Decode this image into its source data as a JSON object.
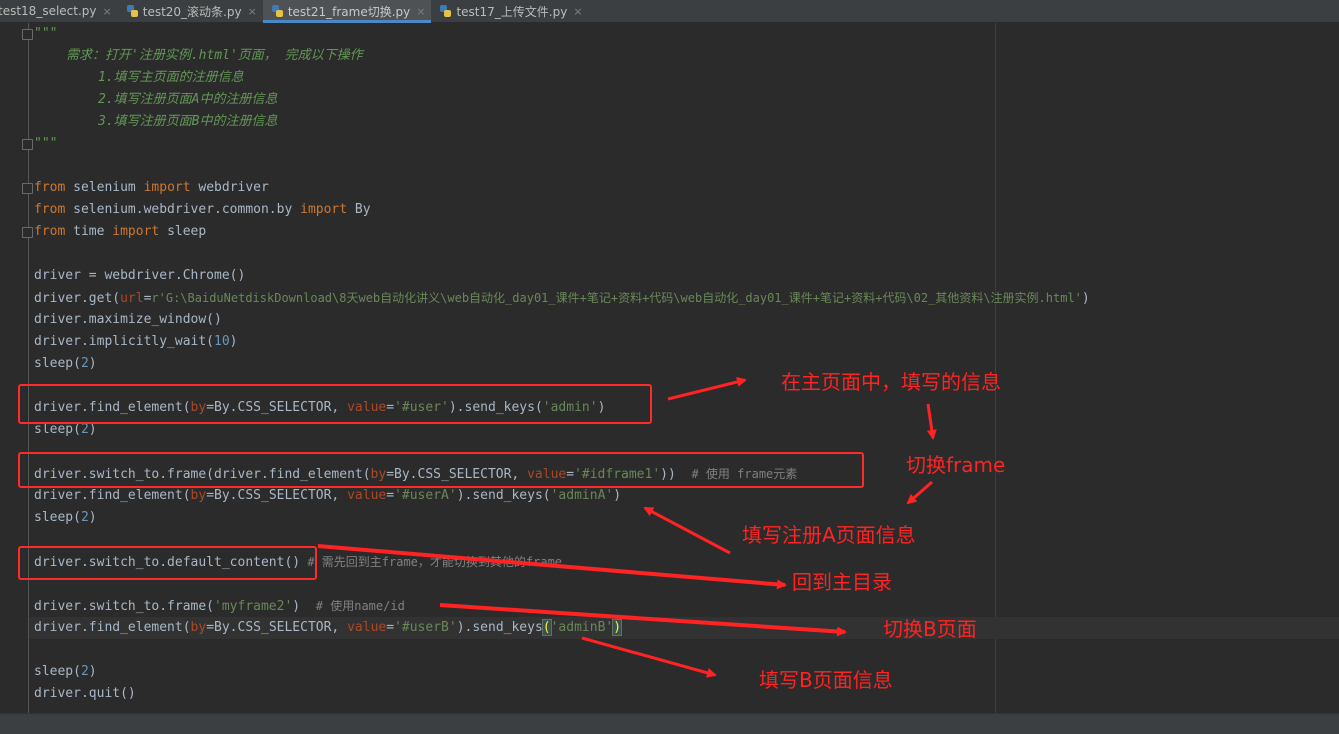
{
  "tabs": [
    {
      "label": "test18_select.py",
      "active": false
    },
    {
      "label": "test20_滚动条.py",
      "active": false
    },
    {
      "label": "test21_frame切换.py",
      "active": true
    },
    {
      "label": "test17_上传文件.py",
      "active": false
    }
  ],
  "tab_close_glyph": "×",
  "code": {
    "doc_open": "\"\"\"",
    "doc_line1": "需求：打开'注册实例.html'页面， 完成以下操作",
    "doc_line2": "1.填写主页面的注册信息",
    "doc_line3": "2.填写注册页面A中的注册信息",
    "doc_line4": "3.填写注册页面B中的注册信息",
    "doc_close": "\"\"\"",
    "import1": {
      "kw1": "from",
      "mod": " selenium ",
      "kw2": "import",
      "name": " webdriver"
    },
    "import2": {
      "kw1": "from",
      "mod": " selenium.webdriver.common.by ",
      "kw2": "import",
      "name": " By"
    },
    "import3": {
      "kw1": "from",
      "mod": " time ",
      "kw2": "import",
      "name": " sleep"
    },
    "driver_init": "driver = webdriver.Chrome()",
    "get": {
      "pre": "driver.get(",
      "param": "url",
      "eq": "=",
      "str": "r'G:\\BaiduNetdiskDownload\\8天web自动化讲义\\web自动化_day01_课件+笔记+资料+代码\\web自动化_day01_课件+笔记+资料+代码\\02_其他资料\\注册实例.html'",
      "post": ")"
    },
    "maximize": "driver.maximize_window()",
    "implicit": {
      "pre": "driver.implicitly_wait(",
      "num": "10",
      "post": ")"
    },
    "sleep": {
      "pre": "sleep(",
      "num": "2",
      "post": ")"
    },
    "find_user": {
      "pre": "driver.find_element(",
      "p1": "by",
      "mid1": "=By.CSS_SELECTOR, ",
      "p2": "value",
      "eq": "=",
      "s1": "'#user'",
      "mid2": ").send_keys(",
      "s2": "'admin'",
      "post": ")"
    },
    "switch_frame": {
      "pre": "driver.switch_to.frame(driver.find_element(",
      "p1": "by",
      "mid1": "=By.CSS_SELECTOR, ",
      "p2": "value",
      "eq": "=",
      "s1": "'#idframe1'",
      "post": "))  ",
      "cmt": "# 使用 frame元素"
    },
    "find_userA": {
      "pre": "driver.find_element(",
      "p1": "by",
      "mid1": "=By.CSS_SELECTOR, ",
      "p2": "value",
      "eq": "=",
      "s1": "'#userA'",
      "mid2": ").send_keys(",
      "s2": "'adminA'",
      "post": ")"
    },
    "default_content": {
      "code": "driver.switch_to.default_content()",
      "cmt": " # 需先回到主frame，才能切换到其他的frame"
    },
    "switch_frame2": {
      "pre": "driver.switch_to.frame(",
      "s1": "'myframe2'",
      "post": ")  ",
      "cmt": "# 使用name/id"
    },
    "find_userB": {
      "pre": "driver.find_element(",
      "p1": "by",
      "mid1": "=By.CSS_SELECTOR, ",
      "p2": "value",
      "eq": "=",
      "s1": "'#userB'",
      "mid2": ").send_keys",
      "open": "(",
      "s2": "'adminB'",
      "close": ")"
    },
    "quit": "driver.quit()"
  },
  "annotations": {
    "main_page": "在主页面中，填写的信息",
    "switch_frame": "切换frame",
    "fill_a": "填写注册A页面信息",
    "back_main": "回到主目录",
    "switch_b": "切换B页面",
    "fill_b": "填写B页面信息"
  },
  "colors": {
    "background": "#2b2b2b",
    "keyword": "#cc7832",
    "string": "#6a8759",
    "number": "#6897bb",
    "param": "#aa4926",
    "docstring": "#629755",
    "annotation_red": "#ff2323"
  }
}
